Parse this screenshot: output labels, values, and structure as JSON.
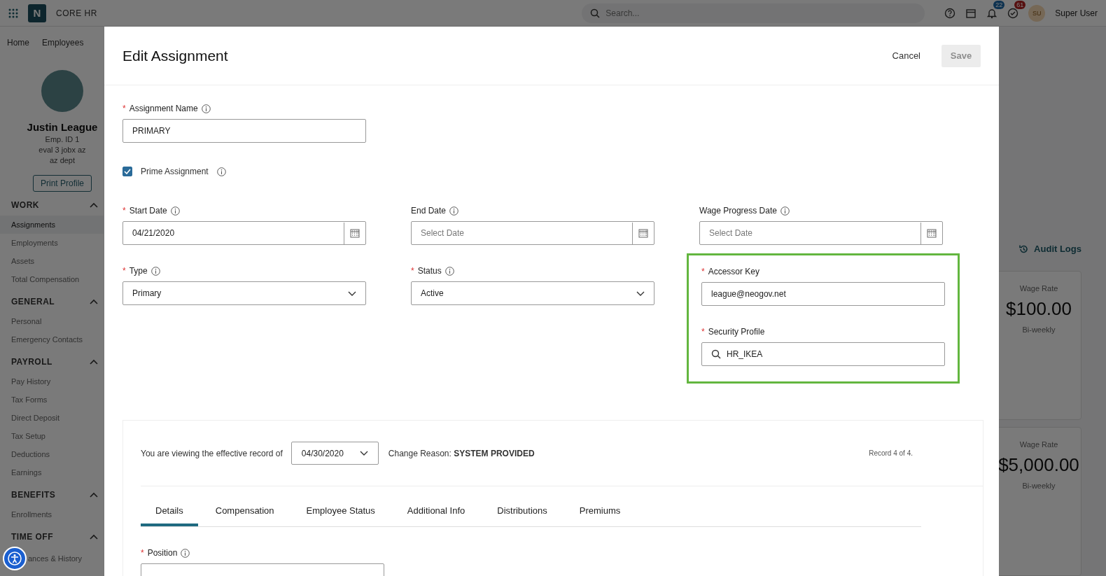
{
  "topbar": {
    "logo": "N",
    "app_name": "CORE HR",
    "search": {
      "placeholder": "Search..."
    },
    "notifications_badge": "22",
    "tasks_badge": "61",
    "user_initials": "SU",
    "user_name": "Super User"
  },
  "nav": [
    "Home",
    "Employees"
  ],
  "profile": {
    "name": "Justin League",
    "details": [
      "Emp. ID 1",
      "eval 3 jobx az",
      "az dept"
    ],
    "print_button": "Print Profile"
  },
  "sidebar": [
    {
      "title": "WORK",
      "expanded": true,
      "items": [
        {
          "label": "Assignments",
          "selected": true
        },
        {
          "label": "Employments",
          "selected": false
        },
        {
          "label": "Assets",
          "selected": false
        },
        {
          "label": "Total Compensation",
          "selected": false
        }
      ]
    },
    {
      "title": "GENERAL",
      "expanded": true,
      "items": [
        {
          "label": "Personal",
          "selected": false
        },
        {
          "label": "Emergency Contacts",
          "selected": false
        }
      ]
    },
    {
      "title": "PAYROLL",
      "expanded": true,
      "items": [
        {
          "label": "Pay History",
          "selected": false
        },
        {
          "label": "Tax Forms",
          "selected": false
        },
        {
          "label": "Direct Deposit",
          "selected": false
        },
        {
          "label": "Tax Setup",
          "selected": false
        },
        {
          "label": "Deductions",
          "selected": false
        },
        {
          "label": "Earnings",
          "selected": false
        }
      ]
    },
    {
      "title": "BENEFITS",
      "expanded": true,
      "items": [
        {
          "label": "Enrollments",
          "selected": false
        }
      ]
    },
    {
      "title": "TIME OFF",
      "expanded": true,
      "items": [
        {
          "label": "ances & History",
          "selected": false
        }
      ]
    }
  ],
  "audit_logs": "Audit Logs",
  "wage_cards": [
    {
      "label": "Wage Rate",
      "amount": "$100.00",
      "period": "Bi-weekly"
    },
    {
      "label": "Wage Rate",
      "amount": "$5,000.00",
      "period": "Bi-weekly"
    }
  ],
  "modal": {
    "title": "Edit Assignment",
    "cancel": "Cancel",
    "save": {
      "label": "Save",
      "disabled": true
    },
    "assignment_name": {
      "label": "Assignment Name",
      "required_mark": "*",
      "info": true,
      "value": "PRIMARY"
    },
    "prime_assignment": {
      "label": "Prime Assignment",
      "checked": true,
      "info": true
    },
    "rows": [
      [
        {
          "kind": "date",
          "label": "Start Date",
          "required_mark": "*",
          "info": true,
          "value": "04/21/2020"
        },
        {
          "kind": "date",
          "label": "End Date",
          "info": true,
          "placeholder": "Select Date"
        },
        {
          "kind": "date",
          "label": "Wage Progress Date",
          "info": true,
          "placeholder": "Select Date"
        }
      ],
      [
        {
          "kind": "select",
          "label": "Type",
          "required_mark": "*",
          "info": true,
          "value": "Primary"
        },
        {
          "kind": "select",
          "label": "Status",
          "required_mark": "*",
          "info": true,
          "value": "Active"
        },
        {
          "kind": "group",
          "highlighted": true,
          "fields": [
            {
              "kind": "text",
              "label": "Accessor Key",
              "required_mark": "*",
              "value": "league@neogov.net"
            },
            {
              "kind": "search",
              "label": "Security Profile",
              "required_mark": "*",
              "value": "HR_IKEA"
            }
          ]
        }
      ]
    ],
    "record": {
      "intro": "You are viewing the effective record of",
      "date": "04/30/2020",
      "reason": "Change Reason: **SYSTEM PROVIDED**",
      "count": "Record 4 of 4."
    },
    "tabs": [
      {
        "label": "Details",
        "selected": true
      },
      {
        "label": "Compensation",
        "selected": false
      },
      {
        "label": "Employee Status",
        "selected": false
      },
      {
        "label": "Additional Info",
        "selected": false
      },
      {
        "label": "Distributions",
        "selected": false
      },
      {
        "label": "Premiums",
        "selected": false
      }
    ],
    "position": {
      "label": "Position",
      "required_mark": "*",
      "info": true
    }
  }
}
